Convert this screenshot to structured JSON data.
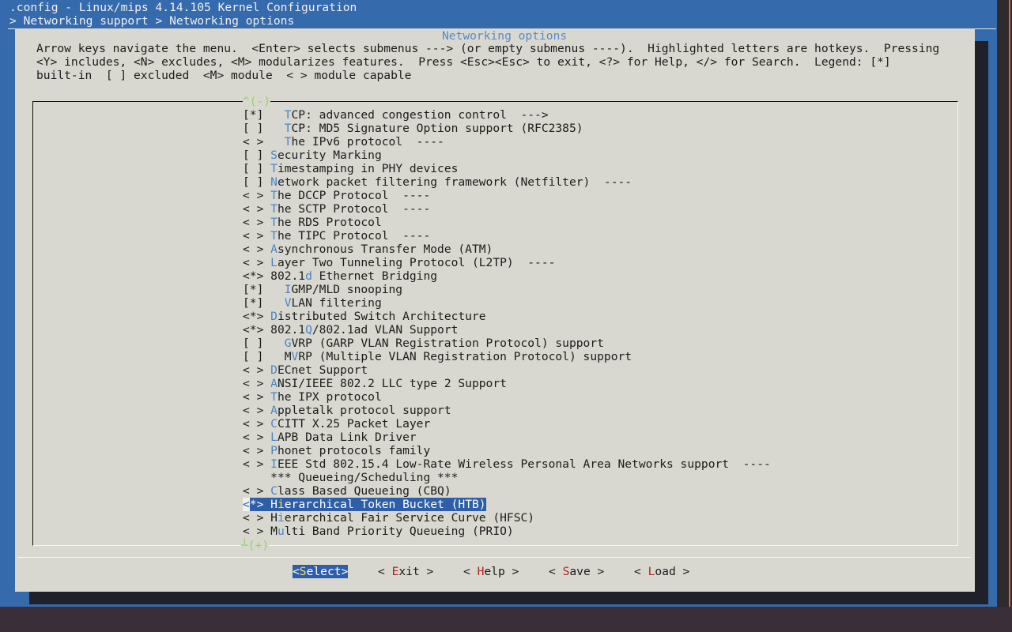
{
  "window": {
    "title": ".config - Linux/mips 4.14.105 Kernel Configuration",
    "breadcrumb": "> Networking support > Networking options"
  },
  "dialog": {
    "title": "Networking options",
    "help": [
      "Arrow keys navigate the menu.  <Enter> selects submenus ---> (or empty submenus ----).  Highlighted letters are hotkeys.  Pressing",
      "<Y> includes, <N> excludes, <M> modularizes features.  Press <Esc><Esc> to exit, <?> for Help, </> for Search.  Legend: [*]",
      "built-in  [ ] excluded  <M> module  < > module capable"
    ],
    "scroll_up": "^(-)",
    "scroll_down": "┴(+)"
  },
  "menu": [
    {
      "state": "[*]",
      "indent": "   ",
      "hk": "T",
      "rest": "CP: advanced congestion control  --->"
    },
    {
      "state": "[ ]",
      "indent": "   ",
      "hk": "T",
      "rest": "CP: MD5 Signature Option support (RFC2385)"
    },
    {
      "state": "< >",
      "indent": "   ",
      "hk": "T",
      "rest": "he IPv6 protocol  ----"
    },
    {
      "state": "[ ]",
      "indent": " ",
      "hk": "S",
      "rest": "ecurity Marking"
    },
    {
      "state": "[ ]",
      "indent": " ",
      "hk": "T",
      "rest": "imestamping in PHY devices"
    },
    {
      "state": "[ ]",
      "indent": " ",
      "hk": "N",
      "rest": "etwork packet filtering framework (Netfilter)  ----"
    },
    {
      "state": "< >",
      "indent": " ",
      "hk": "T",
      "rest": "he DCCP Protocol  ----"
    },
    {
      "state": "< >",
      "indent": " ",
      "hk": "T",
      "rest": "he SCTP Protocol  ----"
    },
    {
      "state": "< >",
      "indent": " ",
      "hk": "T",
      "rest": "he RDS Protocol"
    },
    {
      "state": "< >",
      "indent": " ",
      "hk": "T",
      "rest": "he TIPC Protocol  ----"
    },
    {
      "state": "< >",
      "indent": " ",
      "hk": "A",
      "rest": "synchronous Transfer Mode (ATM)"
    },
    {
      "state": "< >",
      "indent": " ",
      "hk": "L",
      "rest": "ayer Two Tunneling Protocol (L2TP)  ----"
    },
    {
      "state": "<*>",
      "indent": " ",
      "pre": "802.1",
      "hk": "d",
      "rest": " Ethernet Bridging"
    },
    {
      "state": "[*]",
      "indent": "   ",
      "hk": "I",
      "rest": "GMP/MLD snooping"
    },
    {
      "state": "[*]",
      "indent": "   ",
      "hk": "V",
      "rest": "LAN filtering"
    },
    {
      "state": "<*>",
      "indent": " ",
      "hk": "D",
      "rest": "istributed Switch Architecture"
    },
    {
      "state": "<*>",
      "indent": " ",
      "pre": "802.1",
      "hk": "Q",
      "rest": "/802.1ad VLAN Support"
    },
    {
      "state": "[ ]",
      "indent": "   ",
      "hk": "G",
      "rest": "VRP (GARP VLAN Registration Protocol) support"
    },
    {
      "state": "[ ]",
      "indent": "   ",
      "pre": "M",
      "hk": "V",
      "rest": "RP (Multiple VLAN Registration Protocol) support"
    },
    {
      "state": "< >",
      "indent": " ",
      "hk": "D",
      "rest": "ECnet Support"
    },
    {
      "state": "< >",
      "indent": " ",
      "hk": "A",
      "rest": "NSI/IEEE 802.2 LLC type 2 Support"
    },
    {
      "state": "< >",
      "indent": " ",
      "hk": "T",
      "rest": "he IPX protocol"
    },
    {
      "state": "< >",
      "indent": " ",
      "hk": "A",
      "rest": "ppletalk protocol support"
    },
    {
      "state": "< >",
      "indent": " ",
      "hk": "C",
      "rest": "CITT X.25 Packet Layer"
    },
    {
      "state": "< >",
      "indent": " ",
      "hk": "L",
      "rest": "APB Data Link Driver"
    },
    {
      "state": "< >",
      "indent": " ",
      "hk": "P",
      "rest": "honet protocols family"
    },
    {
      "state": "< >",
      "indent": " ",
      "hk": "I",
      "rest": "EEE Std 802.15.4 Low-Rate Wireless Personal Area Networks support  ----"
    },
    {
      "state": "   ",
      "indent": " ",
      "rest": "*** Queueing/Scheduling ***"
    },
    {
      "state": "< >",
      "indent": " ",
      "hk": "C",
      "rest": "lass Based Queueing (CBQ)"
    },
    {
      "state": "<*>",
      "indent": " ",
      "pre": "H",
      "hk": "i",
      "rest": "erarchical Token Bucket (HTB)",
      "selected": true
    },
    {
      "state": "< >",
      "indent": " ",
      "pre": "H",
      "hk": "i",
      "rest": "erarchical Fair Service Curve (HFSC)"
    },
    {
      "state": "< >",
      "indent": " ",
      "pre": "M",
      "hk": "u",
      "rest": "lti Band Priority Queueing (PRIO)"
    }
  ],
  "buttons": [
    {
      "name": "select-button",
      "left": "<",
      "hk": "S",
      "rest": "elect",
      "right": ">",
      "active": true
    },
    {
      "name": "exit-button",
      "left": "< ",
      "hk": "E",
      "rest": "xit",
      "right": " >"
    },
    {
      "name": "help-button",
      "left": "< ",
      "hk": "H",
      "rest": "elp",
      "right": " >"
    },
    {
      "name": "save-button",
      "left": "< ",
      "hk": "S",
      "rest": "ave",
      "right": " >"
    },
    {
      "name": "load-button",
      "left": "< ",
      "hk": "L",
      "rest": "oad",
      "right": " >"
    }
  ],
  "background_text": "                                                                                                              "
}
